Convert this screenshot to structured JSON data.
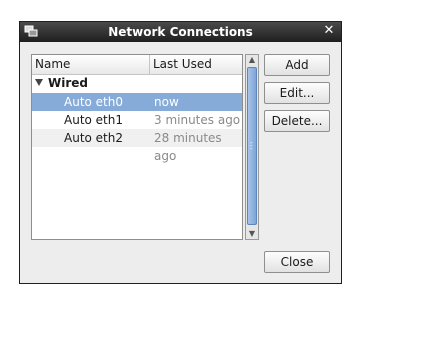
{
  "window": {
    "title": "Network Connections"
  },
  "table": {
    "columns": [
      "Name",
      "Last Used"
    ],
    "group": {
      "name": "Wired"
    },
    "rows": [
      {
        "name": "Auto eth0",
        "last_used": "now",
        "selected": true
      },
      {
        "name": "Auto eth1",
        "last_used": "3 minutes ago",
        "selected": false
      },
      {
        "name": "Auto eth2",
        "last_used": "28 minutes ago",
        "selected": false
      }
    ]
  },
  "buttons": {
    "add": "Add",
    "edit": "Edit...",
    "delete": "Delete...",
    "close": "Close"
  },
  "colors": {
    "selection": "#86abd9",
    "titlebar": "#2e2e2e",
    "window_bg": "#ededed"
  },
  "icons": {
    "title_icon": "network-icon",
    "close_icon": "close-icon"
  }
}
